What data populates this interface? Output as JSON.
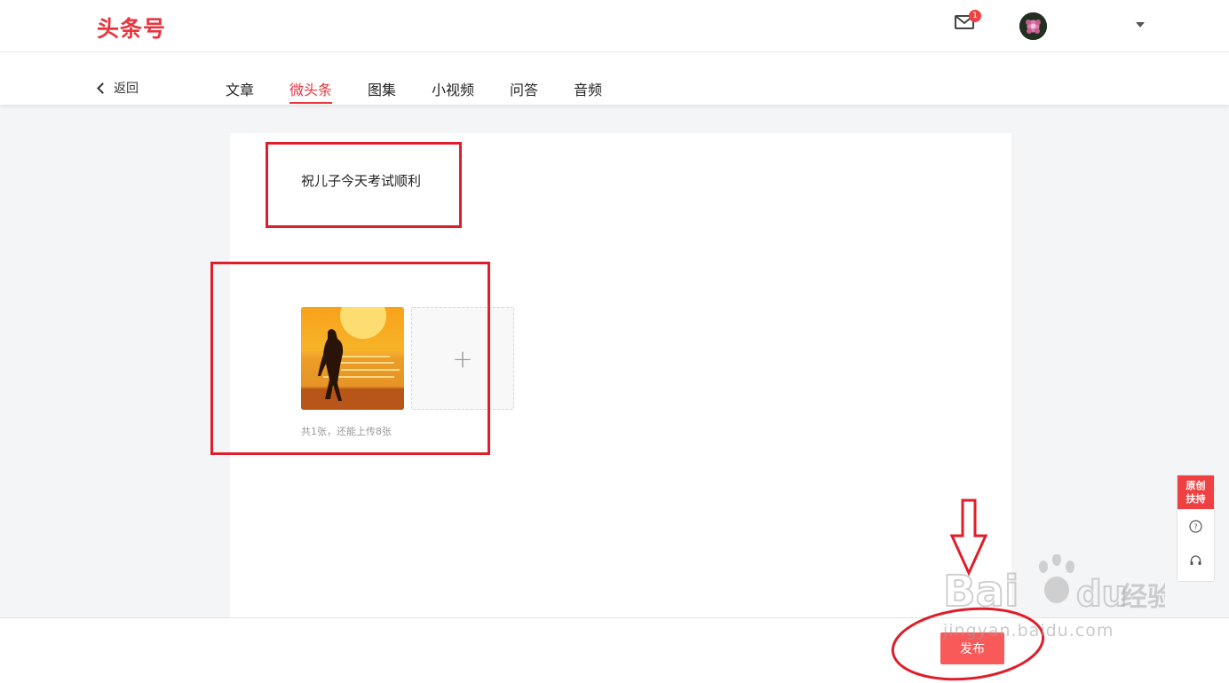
{
  "header": {
    "logo": "头条号",
    "mail_badge": "1"
  },
  "nav": {
    "back_label": "返回",
    "tabs": [
      {
        "label": "文章",
        "active": false
      },
      {
        "label": "微头条",
        "active": true
      },
      {
        "label": "图集",
        "active": false
      },
      {
        "label": "小视频",
        "active": false
      },
      {
        "label": "问答",
        "active": false
      },
      {
        "label": "音频",
        "active": false
      }
    ]
  },
  "editor": {
    "post_text": "祝儿子今天考试顺利",
    "add_tile_glyph": "+",
    "image_count_hint": "共1张，还能上传8张"
  },
  "side": {
    "promo_label_line1": "原创",
    "promo_label_line2": "扶持"
  },
  "footer": {
    "publish_label": "发布"
  },
  "watermark": {
    "url": "jingyan.baidu.com"
  },
  "colors": {
    "brand_red": "#e8353f",
    "annotation_red": "#e01e2a",
    "publish_button": "#f85959"
  }
}
